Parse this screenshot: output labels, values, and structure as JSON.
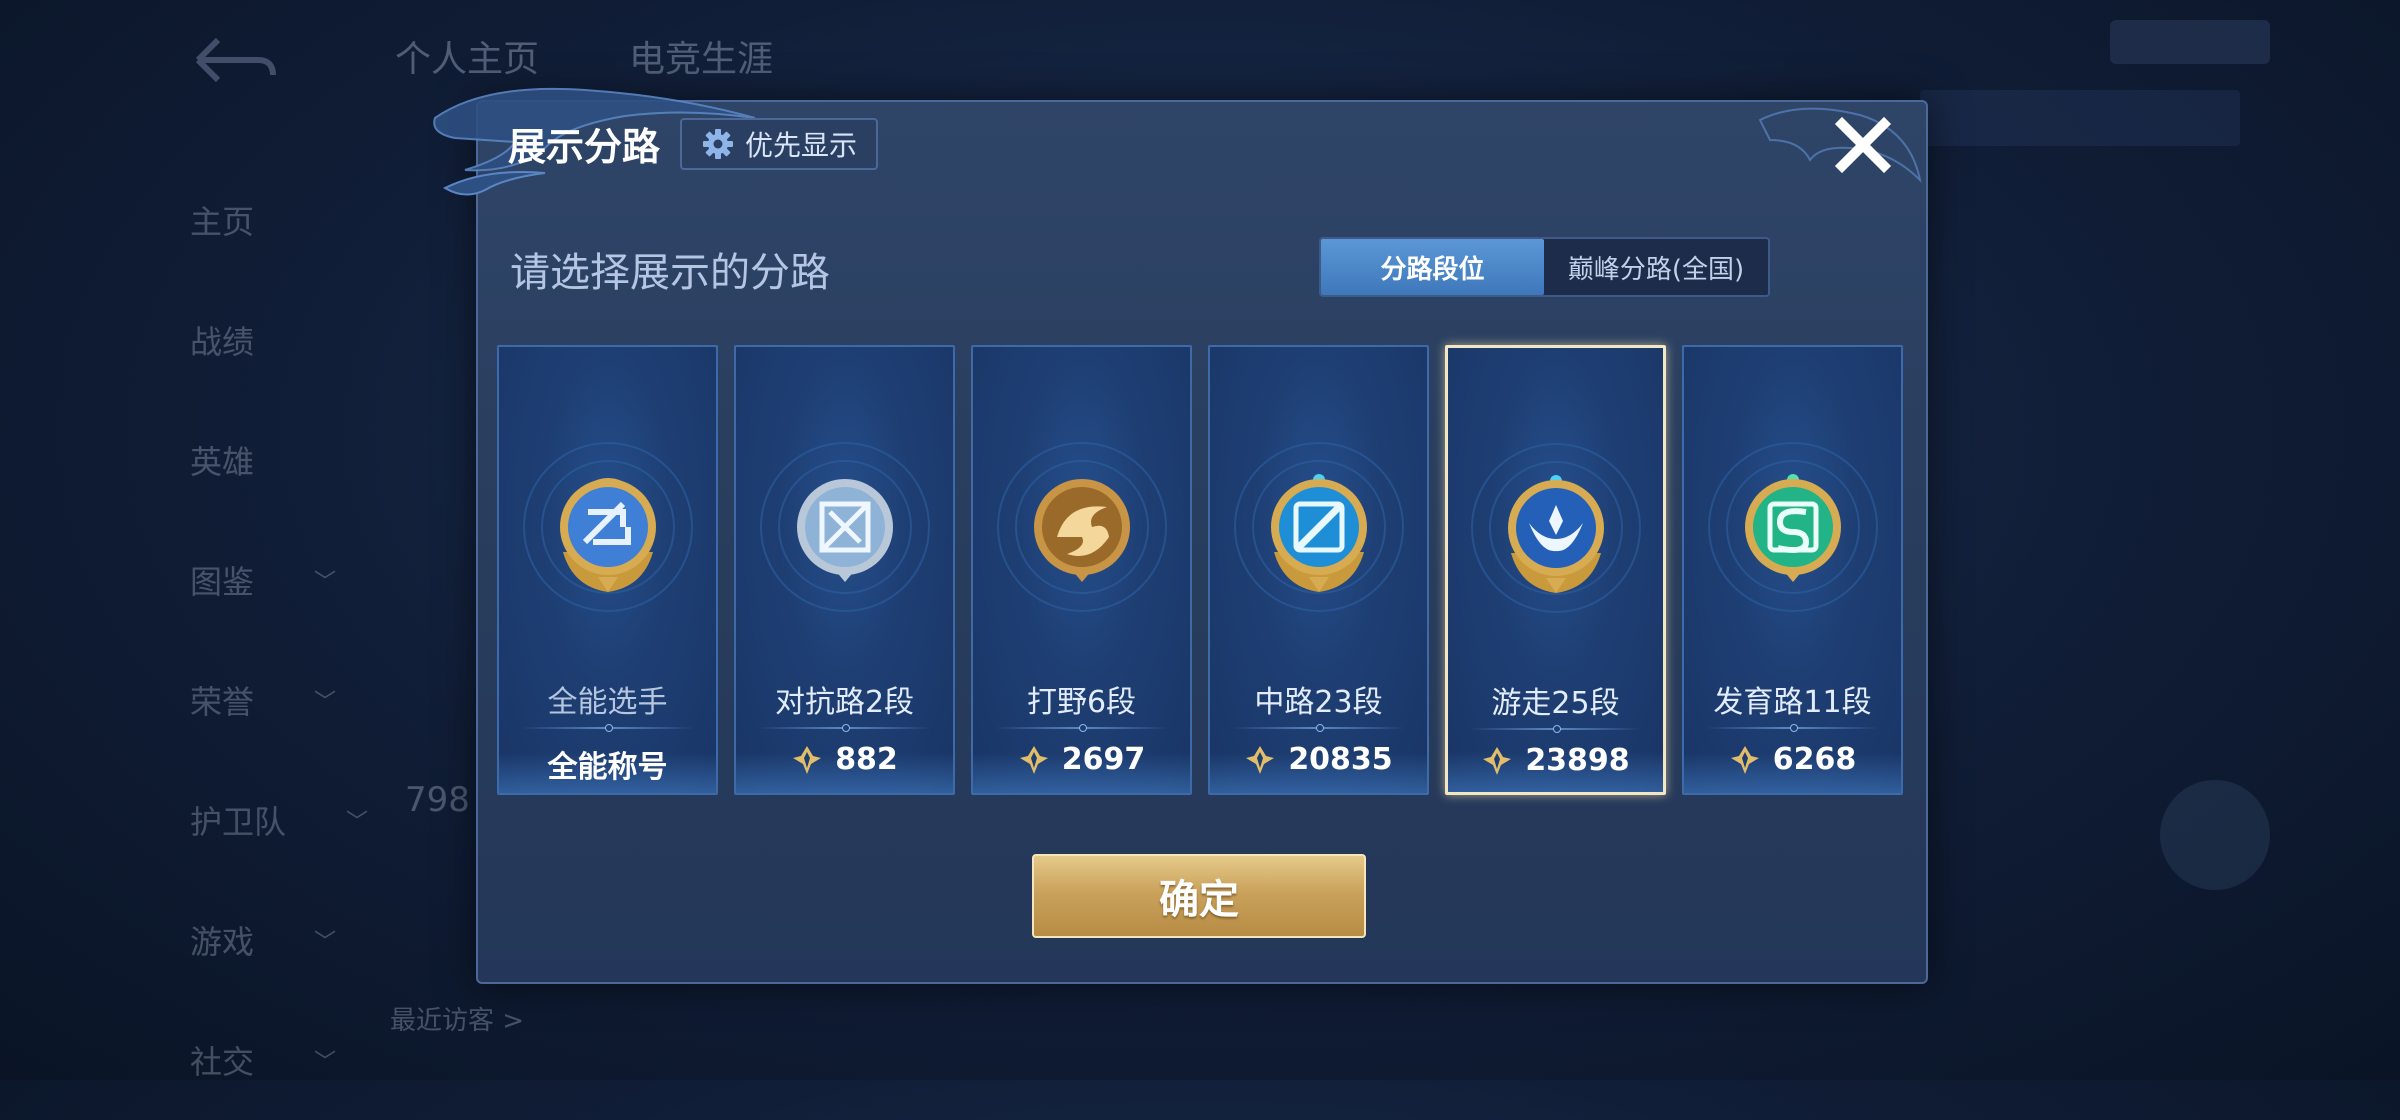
{
  "background": {
    "tabs": [
      "个人主页",
      "电竞生涯"
    ],
    "sidebar": [
      {
        "label": "主页",
        "arrow": ""
      },
      {
        "label": "战绩",
        "arrow": ""
      },
      {
        "label": "英雄",
        "arrow": ""
      },
      {
        "label": "图鉴",
        "arrow": "﹀"
      },
      {
        "label": "荣誉",
        "arrow": "﹀"
      },
      {
        "label": "护卫队",
        "arrow": "﹀"
      },
      {
        "label": "游戏",
        "arrow": "﹀"
      },
      {
        "label": "社交",
        "arrow": "﹀"
      }
    ],
    "number": "798",
    "bottom_link": "最近访客 >"
  },
  "modal": {
    "title": "展示分路",
    "priority_label": "优先显示",
    "subtitle": "请选择展示的分路",
    "segment": {
      "active": "分路段位",
      "other": "巅峰分路(全国)"
    },
    "cards": [
      {
        "name": "全能选手",
        "score": "全能称号",
        "icon": "all-round-emblem",
        "has_score_icon": false,
        "selected": false,
        "color": "#3f7fd6"
      },
      {
        "name": "对抗路2段",
        "score": "882",
        "icon": "clash-lane-emblem",
        "has_score_icon": true,
        "selected": false,
        "color": "#9fb9d6"
      },
      {
        "name": "打野6段",
        "score": "2697",
        "icon": "jungle-emblem",
        "has_score_icon": true,
        "selected": false,
        "color": "#b5823a"
      },
      {
        "name": "中路23段",
        "score": "20835",
        "icon": "mid-lane-emblem",
        "has_score_icon": true,
        "selected": false,
        "color": "#33a5e8"
      },
      {
        "name": "游走25段",
        "score": "23898",
        "icon": "roam-emblem",
        "has_score_icon": true,
        "selected": true,
        "color": "#2b6fc4"
      },
      {
        "name": "发育路11段",
        "score": "6268",
        "icon": "farm-lane-emblem",
        "has_score_icon": true,
        "selected": false,
        "color": "#2fbf93"
      }
    ],
    "confirm_label": "确定"
  },
  "colors": {
    "accent_gold": "#caa25c",
    "selected_border": "#f3e6c3",
    "segment_active": "#4a86c9"
  }
}
